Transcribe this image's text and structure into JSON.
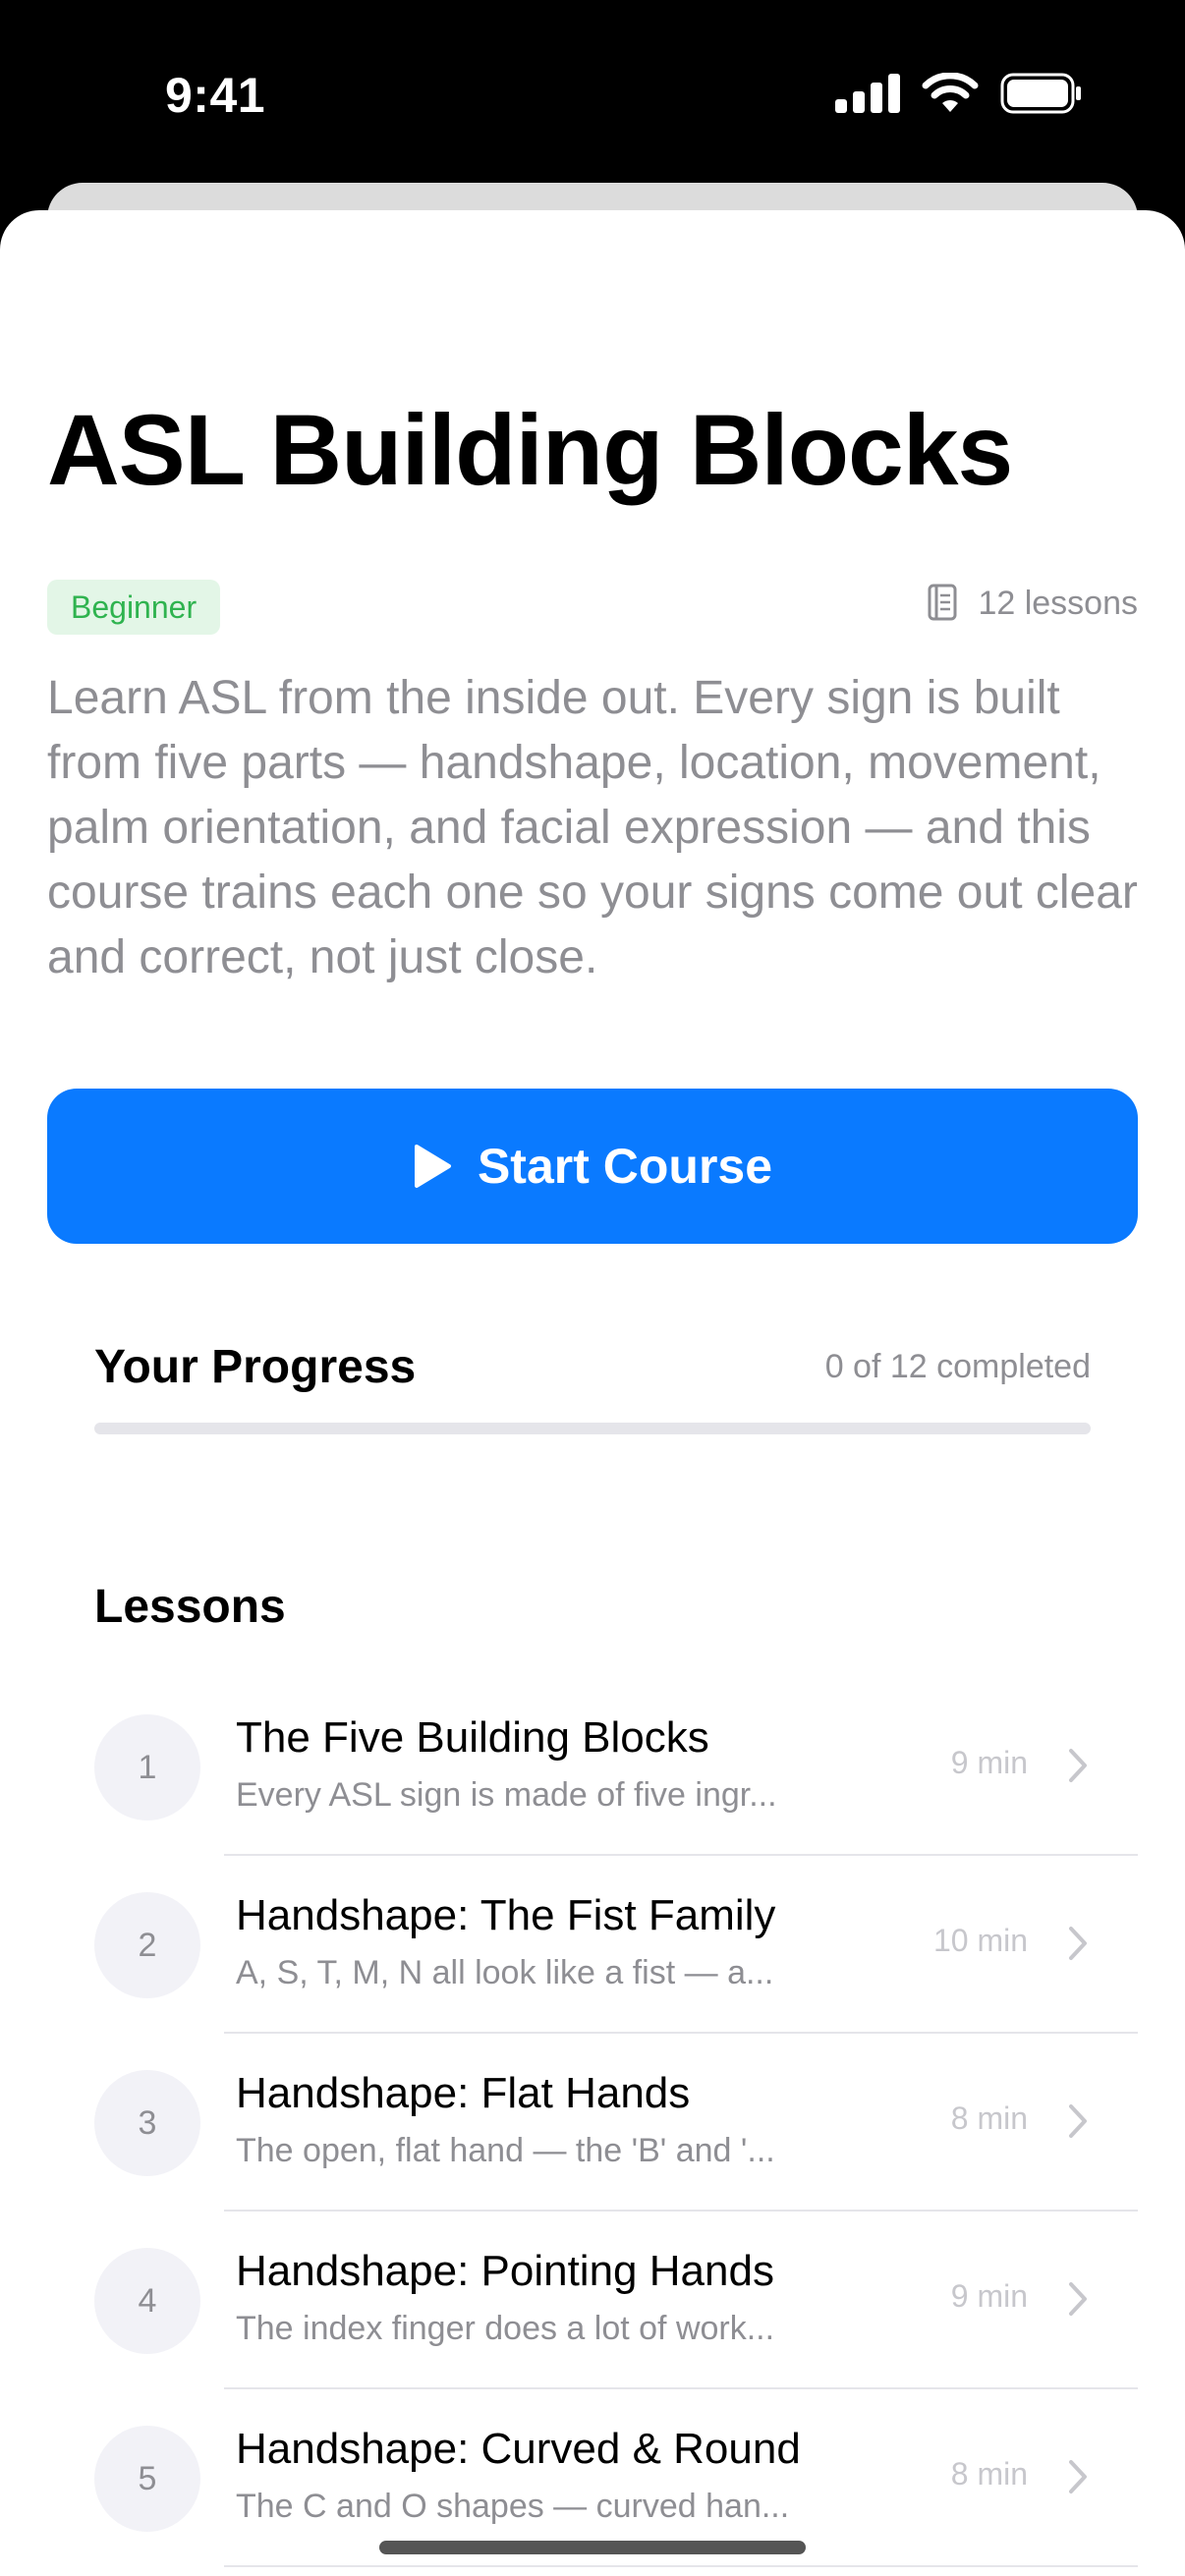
{
  "status_bar": {
    "time": "9:41"
  },
  "course": {
    "title": "ASL Building Blocks",
    "level": "Beginner",
    "lesson_count": "12 lessons",
    "description": "Learn ASL from the inside out. Every sign is built from five parts — handshape, location, movement, palm orientation, and facial expression — and this course trains each one so your signs come out clear and correct, not just close.",
    "start_label": "Start Course"
  },
  "progress": {
    "title": "Your Progress",
    "status": "0 of 12 completed",
    "fraction": 0
  },
  "lessons_heading": "Lessons",
  "lessons": [
    {
      "number": "1",
      "title": "The Five Building Blocks",
      "subtitle": "Every ASL sign is made of five ingr...",
      "duration": "9 min"
    },
    {
      "number": "2",
      "title": "Handshape: The Fist Family",
      "subtitle": "A, S, T, M, N all look like a fist — a...",
      "duration": "10 min"
    },
    {
      "number": "3",
      "title": "Handshape: Flat Hands",
      "subtitle": "The open, flat hand — the 'B' and '...",
      "duration": "8 min"
    },
    {
      "number": "4",
      "title": "Handshape: Pointing Hands",
      "subtitle": "The index finger does a lot of work...",
      "duration": "9 min"
    },
    {
      "number": "5",
      "title": "Handshape: Curved & Round",
      "subtitle": "The C and O shapes — curved han...",
      "duration": "8 min"
    }
  ],
  "colors": {
    "accent": "#0a7aff",
    "badge_text": "#2fb34f",
    "badge_bg": "#e3f6e7",
    "secondary_text": "#8e8e93"
  }
}
